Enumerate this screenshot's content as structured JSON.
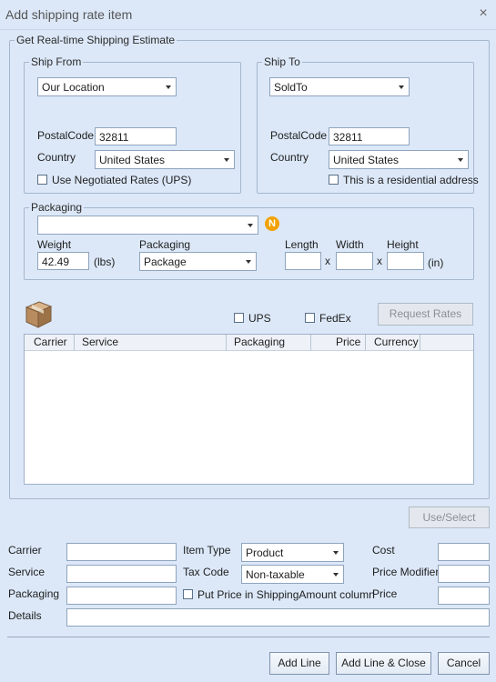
{
  "window": {
    "title": "Add shipping rate item",
    "close_symbol": "×"
  },
  "estimate_group": {
    "legend": "Get Real-time Shipping Estimate"
  },
  "ship_from": {
    "legend": "Ship From",
    "location": "Our Location",
    "postal_label": "PostalCode",
    "postal_value": "32811",
    "country_label": "Country",
    "country_value": "United States",
    "negotiated_label": "Use Negotiated Rates (UPS)"
  },
  "ship_to": {
    "legend": "Ship To",
    "location": "SoldTo",
    "postal_label": "PostalCode",
    "postal_value": "32811",
    "country_label": "Country",
    "country_value": "United States",
    "residential_label": "This is a residential address"
  },
  "packaging_group": {
    "legend": "Packaging",
    "preset_value": "",
    "badge": "N",
    "weight_label": "Weight",
    "weight_value": "42.49",
    "weight_unit": "(lbs)",
    "packaging_label": "Packaging",
    "packaging_value": "Package",
    "length_label": "Length",
    "width_label": "Width",
    "height_label": "Height",
    "times": "x",
    "dim_unit": "(in)"
  },
  "carriers": {
    "ups_label": "UPS",
    "fedex_label": "FedEx",
    "request_rates_label": "Request Rates"
  },
  "rates_table": {
    "columns": [
      "Carrier",
      "Service",
      "Packaging",
      "Price",
      "Currency"
    ],
    "rows": []
  },
  "use_select_label": "Use/Select",
  "form": {
    "carrier_label": "Carrier",
    "service_label": "Service",
    "packaging_label": "Packaging",
    "details_label": "Details",
    "item_type_label": "Item Type",
    "item_type_value": "Product",
    "tax_code_label": "Tax Code",
    "tax_code_value": "Non-taxable",
    "put_price_label": "Put Price in ShippingAmount column",
    "cost_label": "Cost",
    "price_modifier_label": "Price Modifier",
    "price_label": "Price"
  },
  "footer": {
    "add_line_label": "Add Line",
    "add_line_close_label": "Add Line & Close",
    "cancel_label": "Cancel"
  },
  "colors": {
    "background": "#dce8f8",
    "border": "#a7b7cc",
    "badge": "#f2a100"
  }
}
